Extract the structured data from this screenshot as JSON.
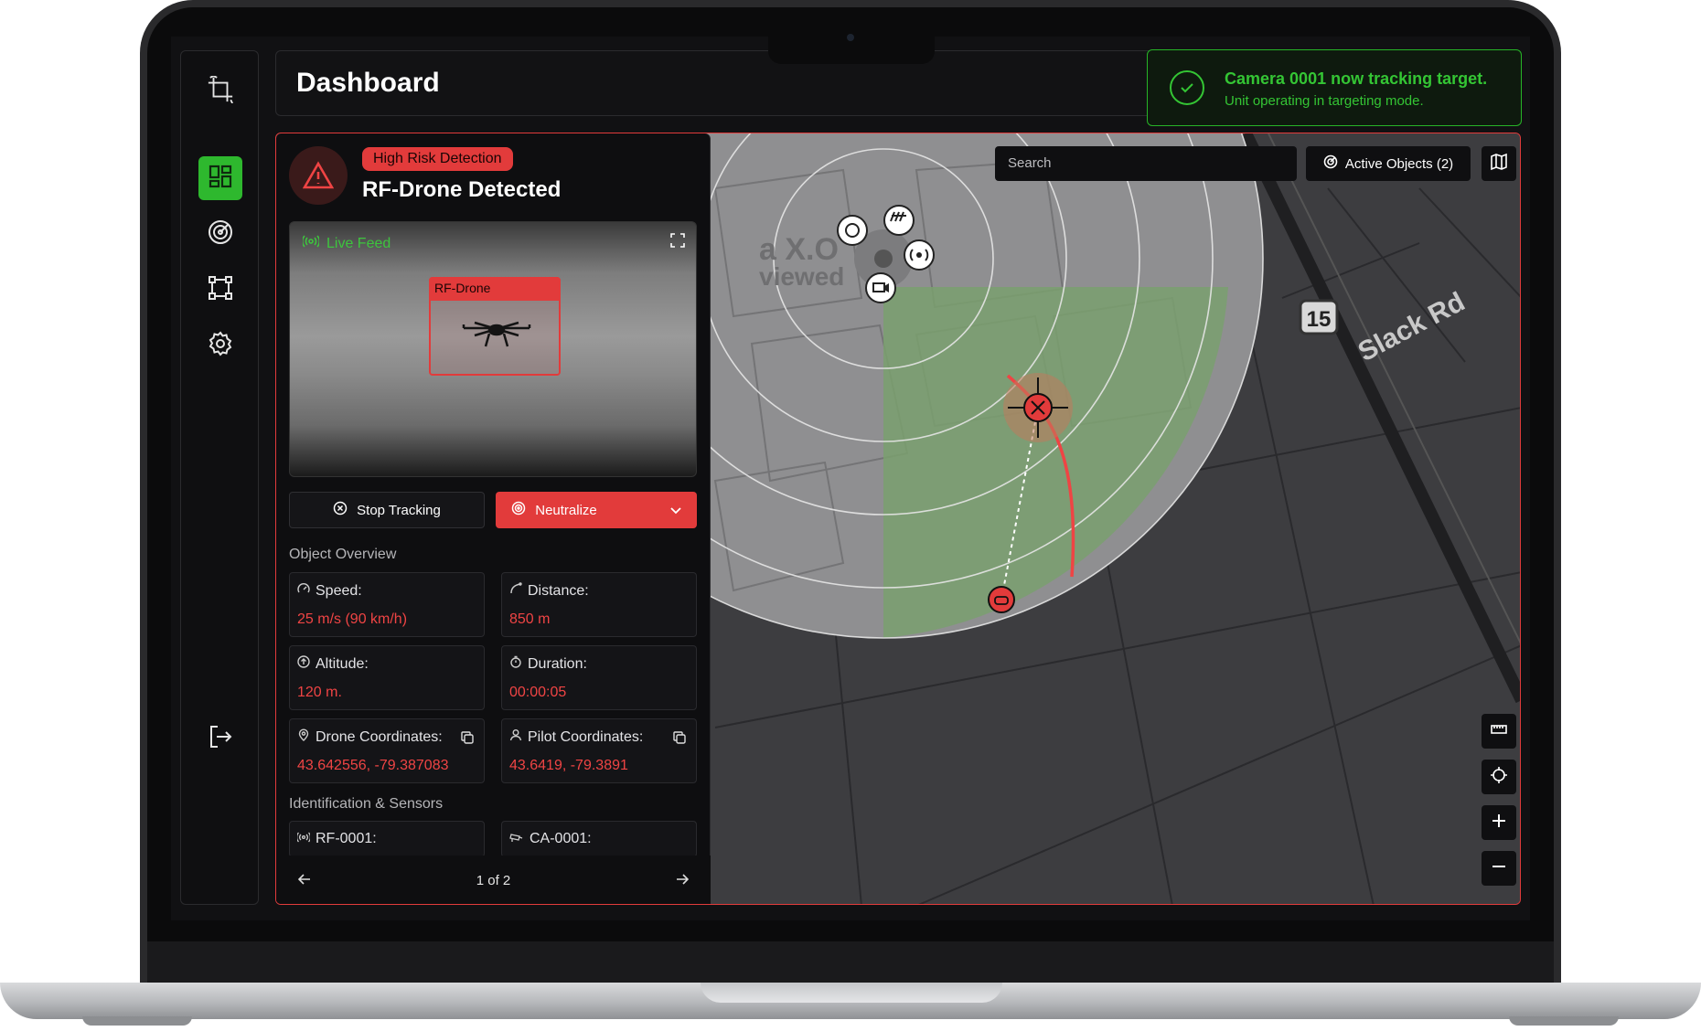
{
  "header": {
    "title": "Dashboard"
  },
  "toast": {
    "title": "Camera 0001 now tracking target.",
    "subtitle": "Unit operating in targeting mode."
  },
  "sidebar": {
    "items": [
      {
        "icon": "logo-crop-icon"
      },
      {
        "icon": "dashboard-grid-icon",
        "active": true
      },
      {
        "icon": "radar-icon"
      },
      {
        "icon": "bounding-box-icon"
      },
      {
        "icon": "gear-icon"
      },
      {
        "icon": "logout-icon"
      }
    ]
  },
  "detection": {
    "badge": "High Risk Detection",
    "title": "RF-Drone Detected",
    "feed_label": "Live Feed",
    "target_label": "RF-Drone",
    "stop_label": "Stop Tracking",
    "neutralize_label": "Neutralize",
    "overview_label": "Object Overview",
    "stats": {
      "speed": {
        "label": "Speed:",
        "value": "25 m/s (90 km/h)"
      },
      "distance": {
        "label": "Distance:",
        "value": "850 m"
      },
      "altitude": {
        "label": "Altitude:",
        "value": "120 m."
      },
      "duration": {
        "label": "Duration:",
        "value": "00:00:05"
      },
      "drone_coords": {
        "label": "Drone Coordinates:",
        "value": "43.642556, -79.387083"
      },
      "pilot_coords": {
        "label": "Pilot Coordinates:",
        "value": "43.6419, -79.3891"
      }
    },
    "sensors_label": "Identification & Sensors",
    "sensors": {
      "rf": "RF-0001:",
      "ca": "CA-0001:"
    },
    "pager": "1 of 2"
  },
  "map": {
    "search_placeholder": "Search",
    "active_objects": "Active Objects (2)",
    "road_label": "Slack Rd",
    "highway_shield": "15",
    "faded_label_1": "a X.O",
    "faded_label_2": "viewed"
  },
  "colors": {
    "accent_red": "#e23b3b",
    "accent_green": "#34c534",
    "coverage": "#7aa06f"
  }
}
